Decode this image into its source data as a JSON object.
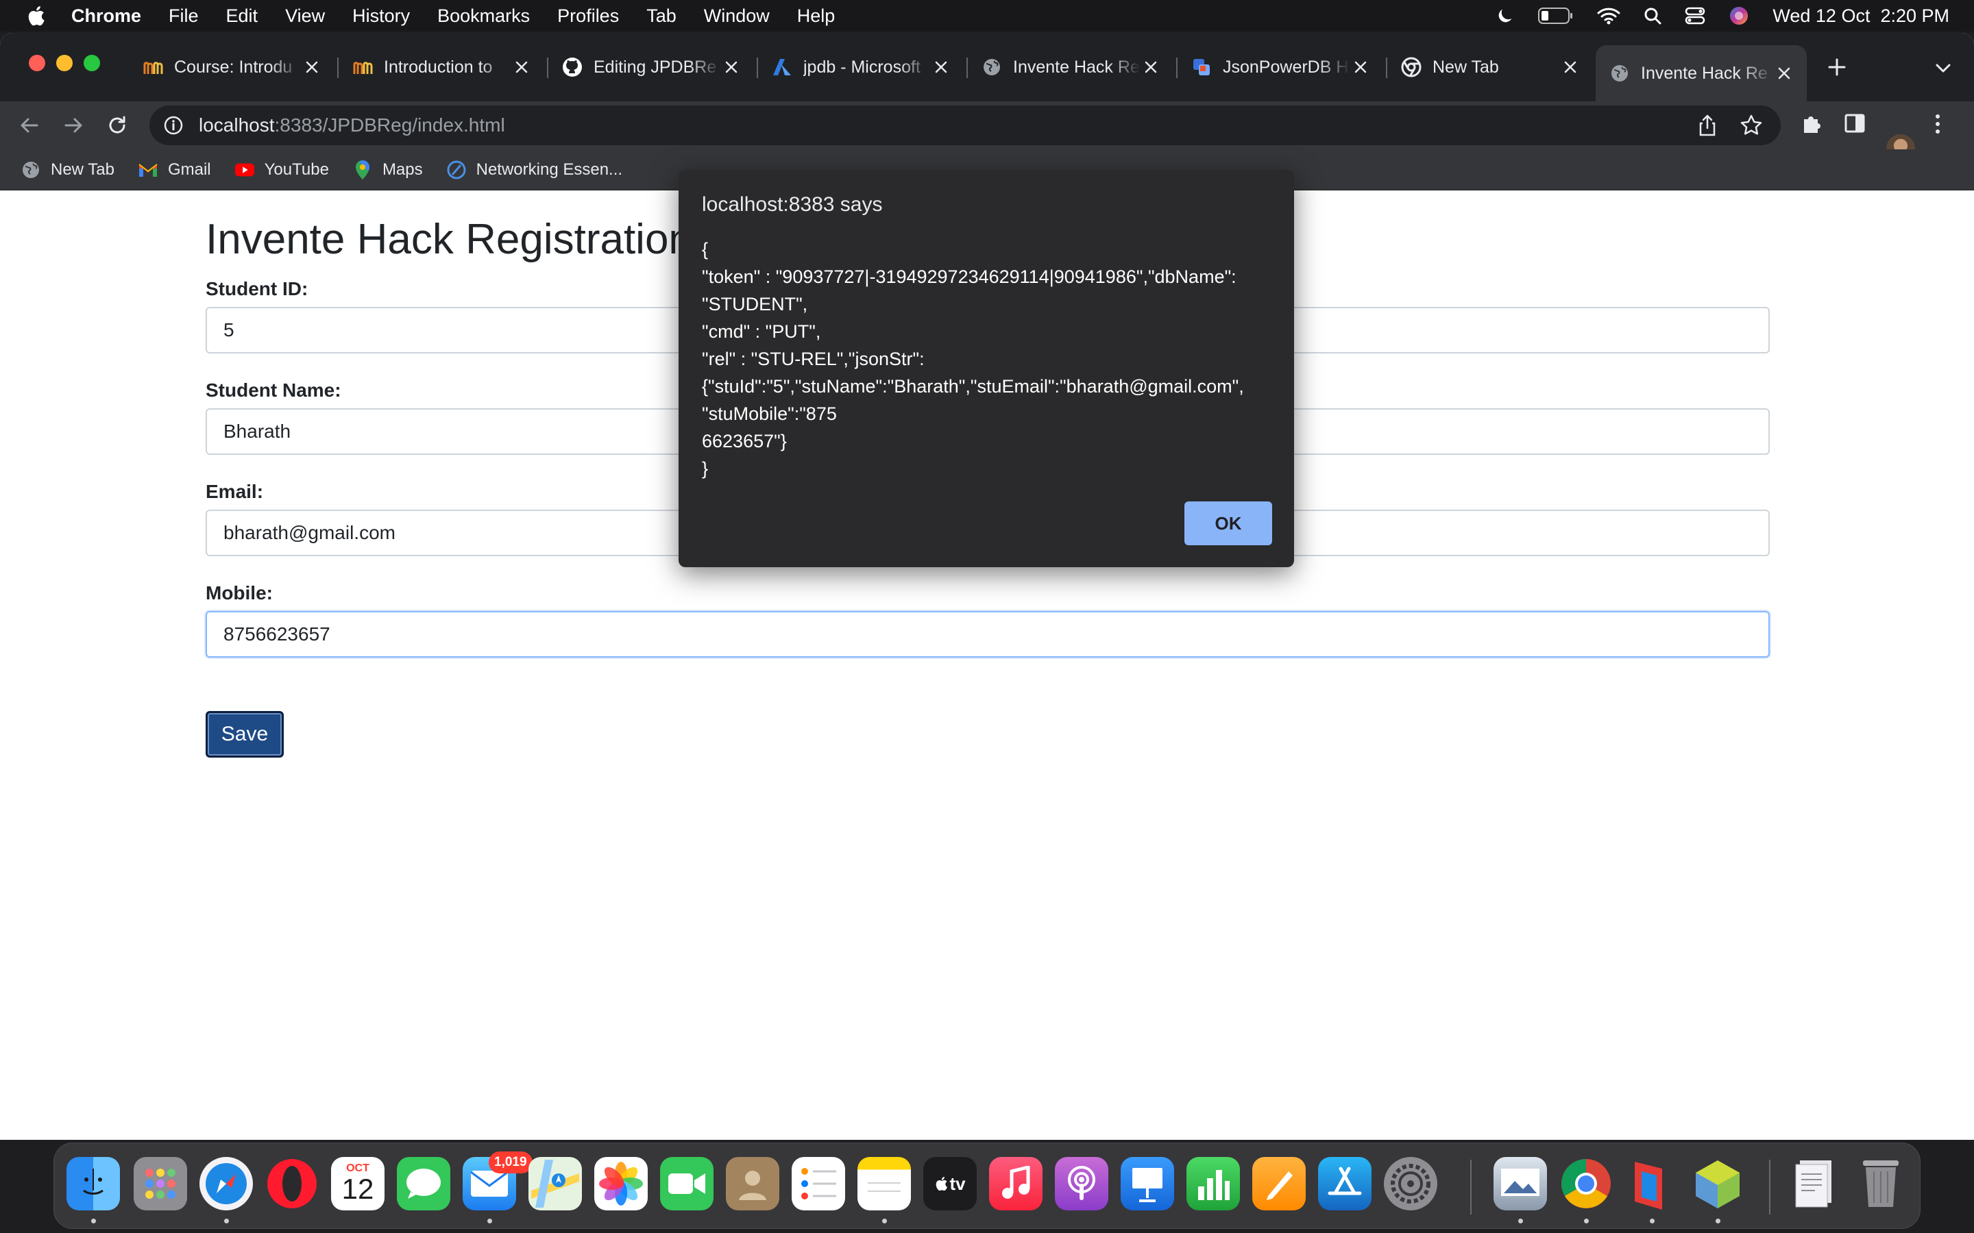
{
  "menubar": {
    "app_name": "Chrome",
    "items": [
      "File",
      "Edit",
      "View",
      "History",
      "Bookmarks",
      "Profiles",
      "Tab",
      "Window",
      "Help"
    ],
    "clock": "Wed 12 Oct  2:20 PM"
  },
  "tabs": [
    {
      "title": "Course: Introdu",
      "icon": "course-icon"
    },
    {
      "title": "Introduction to",
      "icon": "course-icon"
    },
    {
      "title": "Editing JPDBRe",
      "icon": "github-icon"
    },
    {
      "title": "jpdb - Microsoft",
      "icon": "azure-icon"
    },
    {
      "title": "Invente Hack Re",
      "icon": "globe-icon"
    },
    {
      "title": "JsonPowerDB H",
      "icon": "jpdb-icon"
    },
    {
      "title": "New Tab",
      "icon": "chrome-icon"
    },
    {
      "title": "Invente Hack Re",
      "icon": "globe-icon",
      "active": true
    }
  ],
  "address_bar": {
    "host": "localhost",
    "path": ":8383/JPDBReg/index.html"
  },
  "bookmarks": [
    {
      "label": "New Tab",
      "icon": "globe-icon"
    },
    {
      "label": "Gmail",
      "icon": "gmail-icon"
    },
    {
      "label": "YouTube",
      "icon": "youtube-icon"
    },
    {
      "label": "Maps",
      "icon": "maps-icon"
    },
    {
      "label": "Networking Essen...",
      "icon": "cisco-icon"
    }
  ],
  "form": {
    "title": "Invente Hack Registration",
    "fields": [
      {
        "label": "Student ID:",
        "value": "5"
      },
      {
        "label": "Student Name:",
        "value": "Bharath"
      },
      {
        "label": "Email:",
        "value": "bharath@gmail.com"
      },
      {
        "label": "Mobile:",
        "value": "8756623657"
      }
    ],
    "save_label": "Save"
  },
  "dialog": {
    "title": "localhost:8383 says",
    "message_lines": [
      "{",
      "\"token\" : \"90937727|-31949297234629114|90941986\",\"dbName\":",
      "\"STUDENT\",",
      "\"cmd\" : \"PUT\",",
      "\"rel\" : \"STU-REL\",\"jsonStr\":",
      "{\"stuId\":\"5\",\"stuName\":\"Bharath\",\"stuEmail\":\"bharath@gmail.com\",",
      "\"stuMobile\":\"875",
      "6623657\"}",
      "}"
    ],
    "ok_label": "OK"
  },
  "dock": {
    "mail_badge": "1,019",
    "calendar_month": "OCT",
    "calendar_day": "12",
    "tv_label": "tv"
  },
  "colors": {
    "save_button": "#1e4a86",
    "ok_button": "#8ab4f8",
    "dialog_bg": "#2a2a2c"
  }
}
